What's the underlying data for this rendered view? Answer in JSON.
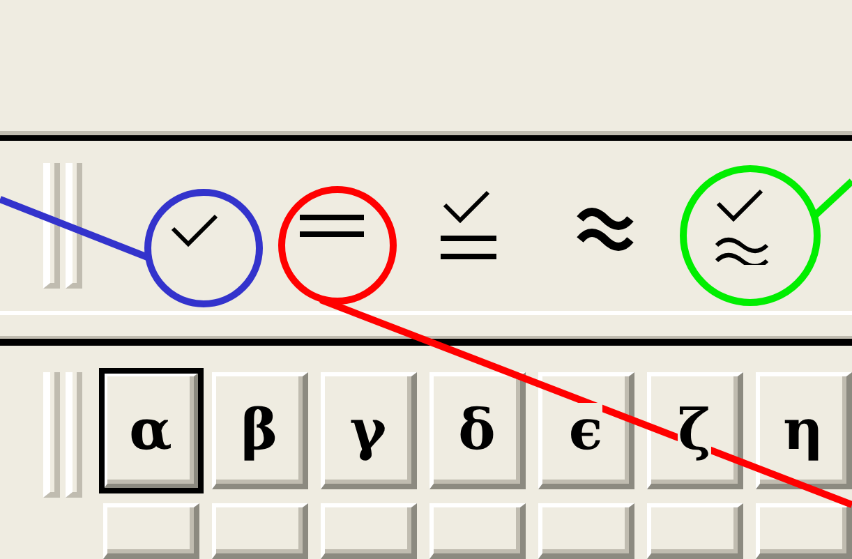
{
  "relation_toolbar": {
    "buttons": [
      {
        "kind": "check"
      },
      {
        "kind": "equals"
      },
      {
        "kind": "check-equals"
      },
      {
        "kind": "approx"
      },
      {
        "kind": "check-approx"
      }
    ]
  },
  "greek_toolbar": {
    "buttons": [
      {
        "label": "α",
        "selected": true
      },
      {
        "label": "β",
        "selected": false
      },
      {
        "label": "γ",
        "selected": false
      },
      {
        "label": "δ",
        "selected": false
      },
      {
        "label": "ϵ",
        "selected": false
      },
      {
        "label": "ζ",
        "selected": false
      },
      {
        "label": "η",
        "selected": false
      }
    ]
  },
  "annotations": [
    {
      "color": "#3333cc"
    },
    {
      "color": "#ff0000"
    },
    {
      "color": "#00ee00"
    }
  ]
}
